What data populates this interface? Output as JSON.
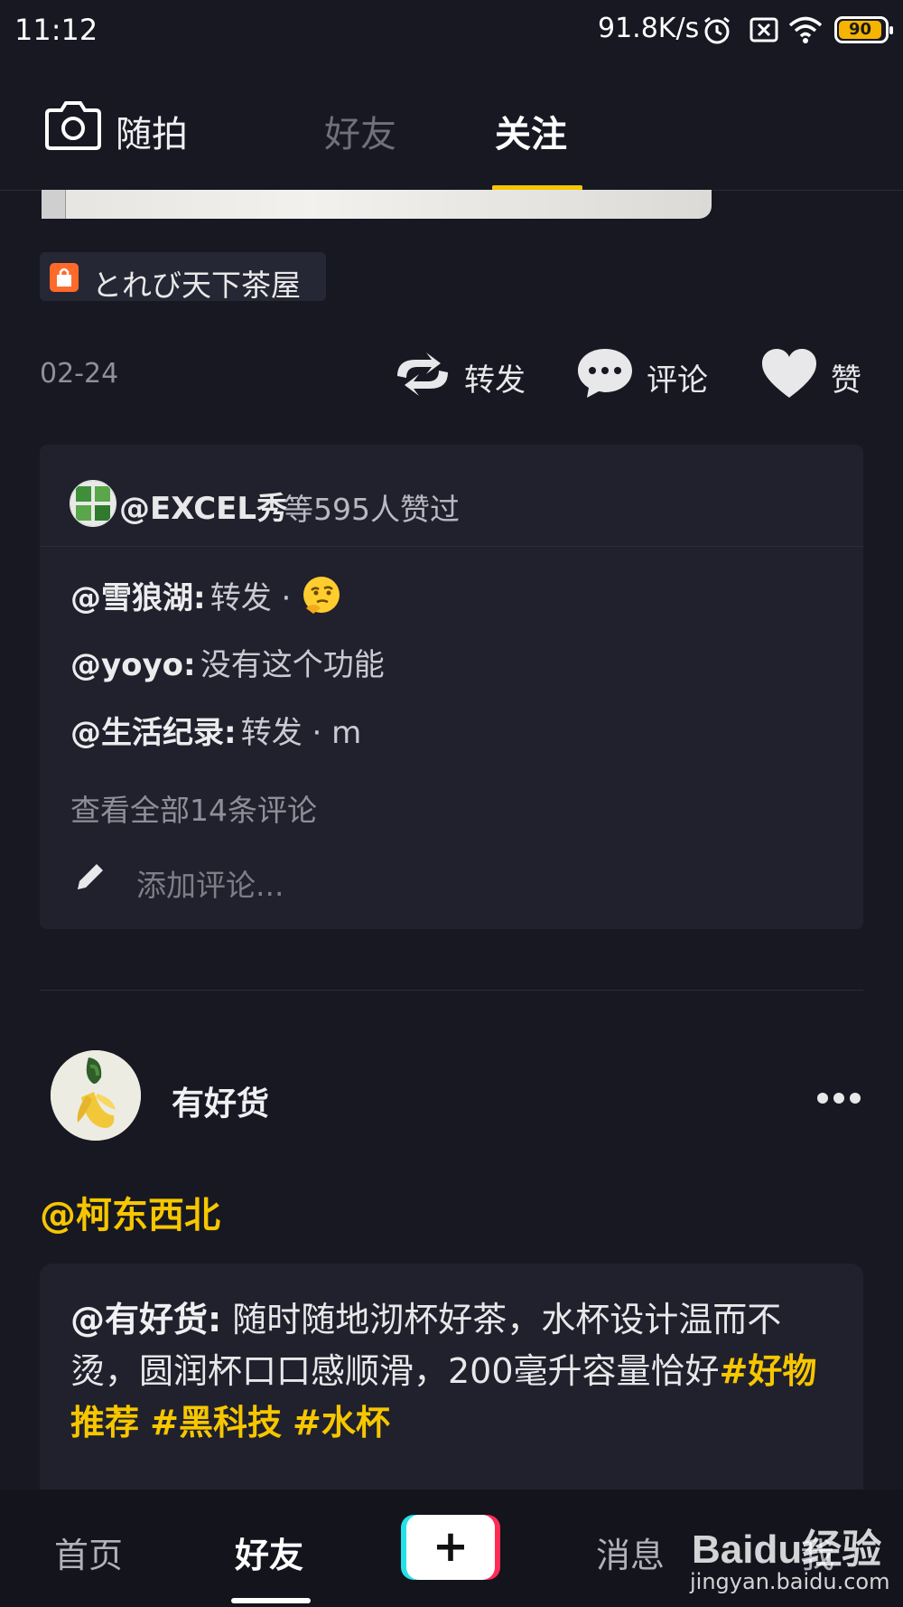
{
  "status_bar": {
    "time": "11:12",
    "network_speed": "91.8K/s",
    "battery": "90",
    "icons": [
      "alarm-icon",
      "sim-x-icon",
      "wifi-icon",
      "battery-icon"
    ]
  },
  "top_nav": {
    "camera_label": "随拍",
    "tabs": [
      {
        "label": "好友",
        "active": false
      },
      {
        "label": "关注",
        "active": true
      }
    ],
    "accent": "#f6c600"
  },
  "post1": {
    "shop_tag": "とれび天下茶屋",
    "date": "02-24",
    "actions": {
      "repost": "转发",
      "comment": "评论",
      "like": "赞"
    },
    "likes": {
      "user": "@EXCEL秀",
      "text": "等595人赞过"
    },
    "comments": [
      {
        "user": "@雪狼湖:",
        "text": "转发 · "
      },
      {
        "user": "@yoyo:",
        "text": "没有这个功能"
      },
      {
        "user": "@生活纪录:",
        "text": "转发 · m"
      }
    ],
    "view_all": "查看全部14条评论",
    "add_comment_placeholder": "添加评论..."
  },
  "post2": {
    "author": "有好货",
    "mention": "@柯东西北",
    "content_user": "@有好货:",
    "content_text": "随时随地沏杯好茶，水杯设计温而不烫，圆润杯口口感顺滑，200毫升容量恰好",
    "hashtags": [
      "#好物推荐",
      "#黑科技",
      "#水杯"
    ]
  },
  "bottom_nav": {
    "items": [
      {
        "label": "首页",
        "active": false
      },
      {
        "label": "好友",
        "active": true
      },
      {
        "label": "消息",
        "active": false
      },
      {
        "label": "我",
        "active": false
      }
    ]
  },
  "watermark": {
    "brand": "Baidu经验",
    "url": "jingyan.baidu.com"
  }
}
